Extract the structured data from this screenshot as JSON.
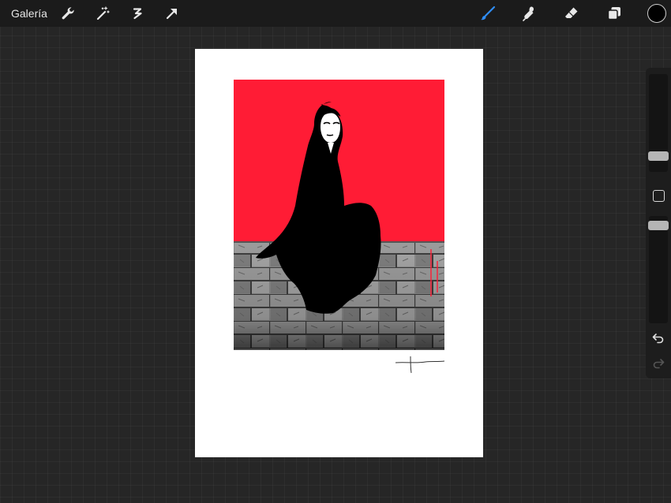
{
  "toolbar": {
    "gallery_label": "Galería",
    "left_icons": [
      "wrench-icon",
      "magic-wand-icon",
      "selection-icon",
      "transform-arrow-icon"
    ],
    "right_icons": [
      "brush-icon",
      "smudge-icon",
      "eraser-icon",
      "layers-icon"
    ],
    "active_tool": "brush",
    "accent_color": "#2f8df5",
    "current_color": "#000000"
  },
  "sidebar": {
    "size_slider_icon": "brush-size-slider",
    "opacity_slider_icon": "opacity-slider",
    "modify_icon": "square-modify-icon",
    "undo_icon": "undo-arrow-icon",
    "redo_icon": "redo-arrow-icon",
    "redo_enabled": false
  },
  "canvas": {
    "background_color": "#ff1c35",
    "figure": "hooded-woman-silhouette",
    "wall": "stone-brick-wall"
  }
}
